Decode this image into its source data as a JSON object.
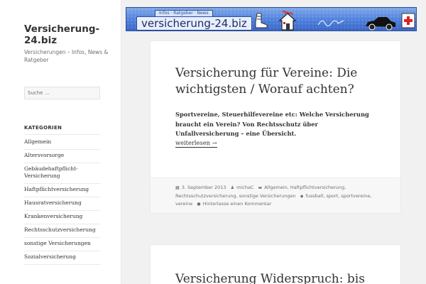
{
  "site": {
    "title": "Versicherung-24.biz",
    "description": "Versicherungen – Infos, News & Ratgeber"
  },
  "search": {
    "placeholder": "Suche …"
  },
  "categories": {
    "heading": "KATEGORIEN",
    "items": [
      "Allgemein",
      "Altersvorsorge",
      "Gebäudehaftpflicht-Versicherung",
      "Haftpflichtversicherung",
      "Hausratversicherung",
      "Krankenversicherung",
      "Rechtsschutzversicherung",
      "sonstige Versicherungen",
      "Sozialversicherung"
    ]
  },
  "banner": {
    "tabs": "Infos · Ratgeber · News",
    "name": "versicherung-24.biz"
  },
  "posts": [
    {
      "title": "Versicherung für Vereine: Die wichtigsten / Worauf achten?",
      "excerpt": "Sportvereine, Steuerhilfevereine etc: Welche Versicherung braucht ein Verein? Von Rechtsschutz über Unfallversicherung – eine Übersicht.",
      "more": "weiterlesen →",
      "meta": {
        "date": "3. September 2013",
        "author": "michaC",
        "categories": "Allgemein, Haftpflichtversicherung, Rechtsschutzversicherung, sonstige Versicherungen",
        "tags": "fussball, sport, sportvereine, vereine",
        "comments": "Hinterlasse einen Kommentar"
      }
    },
    {
      "title": "Versicherung Widerspruch: bis"
    }
  ],
  "colors": {
    "background": "#f1f1f1",
    "banner": "#4d7fdc",
    "text": "#333333",
    "meta": "#707070"
  }
}
